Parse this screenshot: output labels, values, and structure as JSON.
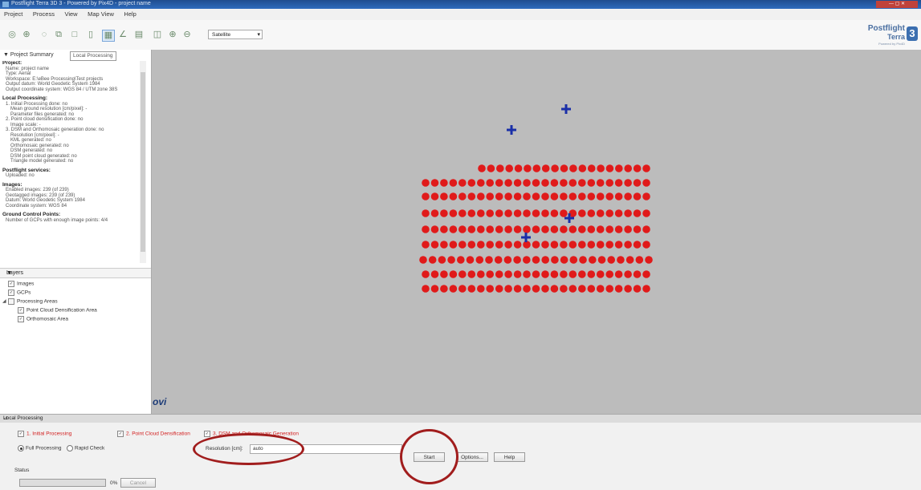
{
  "window": {
    "title": "Postflight Terra 3D 3 - Powered by Pix4D - project name"
  },
  "menu": [
    "Project",
    "Process",
    "View",
    "Map View",
    "Help"
  ],
  "toolbar": {
    "satellite_select": "Satellite",
    "logo_line1": "Postflight",
    "logo_line2": "Terra",
    "logo_sub": "Powered by Pix4D",
    "logo_badge": "3"
  },
  "left_panel": {
    "section_title": "Project Summary",
    "tooltip": "Local Processing",
    "summary": [
      {
        "heading": "Project:",
        "lines": [
          {
            "t": "Name: project name"
          },
          {
            "t": "Type: Aerial"
          },
          {
            "t": "Workspace: E:\\eBee Processing\\Test projects"
          },
          {
            "t": "Output datum: World Geodetic System 1984"
          },
          {
            "t": "Output coordinate system: WGS 84 / UTM zone 38S"
          }
        ]
      },
      {
        "heading": "Local Processing:",
        "lines": [
          {
            "t": "1. Initial Processing done: no"
          },
          {
            "t": "Mean ground resolution [cm/pixel]: -",
            "i": 1
          },
          {
            "t": "Parameter files generated: no",
            "i": 1
          },
          {
            "t": "2. Point cloud densification done: no"
          },
          {
            "t": "Image scale: -",
            "i": 1
          },
          {
            "t": "3. DSM and Orthomosaic generation done: no"
          },
          {
            "t": "Resolution [cm/pixel]: -",
            "i": 1
          },
          {
            "t": "KML generated: no",
            "i": 1
          },
          {
            "t": "Orthomosaic generated: no",
            "i": 1
          },
          {
            "t": "DSM generated: no",
            "i": 1
          },
          {
            "t": "DSM point cloud generated: no",
            "i": 1
          },
          {
            "t": "Triangle model generated: no",
            "i": 1
          }
        ]
      },
      {
        "heading": "Postflight services:",
        "lines": [
          {
            "t": "Uploaded: no"
          }
        ]
      },
      {
        "heading": "Images:",
        "lines": [
          {
            "t": "Enabled images: 239 (of 239)"
          },
          {
            "t": "Geotagged images: 239 (of 239)"
          },
          {
            "t": "Datum: World Geodetic System 1984"
          },
          {
            "t": "Coordinate system: WGS 84"
          }
        ]
      },
      {
        "heading": "Ground Control Points:",
        "lines": [
          {
            "t": "Number of GCPs with enough image points: 4/4"
          }
        ]
      }
    ],
    "layers_title": "Layers",
    "layers": {
      "images": "Images",
      "gcps": "GCPs",
      "processing_areas": "Processing Areas",
      "densification_area": "Point Cloud Densification Area",
      "ortho_area": "Orthomosaic Area"
    }
  },
  "map": {
    "watermark": "ovi"
  },
  "local_processing": {
    "title": "Local Processing",
    "step1": "1. Initial Processing",
    "step2": "2. Point Cloud Densification",
    "step3": "3. DSM and Orthomosaic Generation",
    "full_processing": "Full Processing",
    "rapid_check": "Rapid Check",
    "resolution_label": "Resolution [cm]:",
    "resolution_value": "auto",
    "start": "Start",
    "options": "Options...",
    "help": "Help",
    "status_label": "Status",
    "progress_percent": "0%",
    "progress_fraction": 0.0,
    "cancel": "Cancel"
  },
  "colors": {
    "image_dot": "#e01a1a",
    "gcp_marker": "#1a2fa8",
    "annotation_circle": "#a11d1d",
    "map_bg": "#bcbcbc"
  }
}
